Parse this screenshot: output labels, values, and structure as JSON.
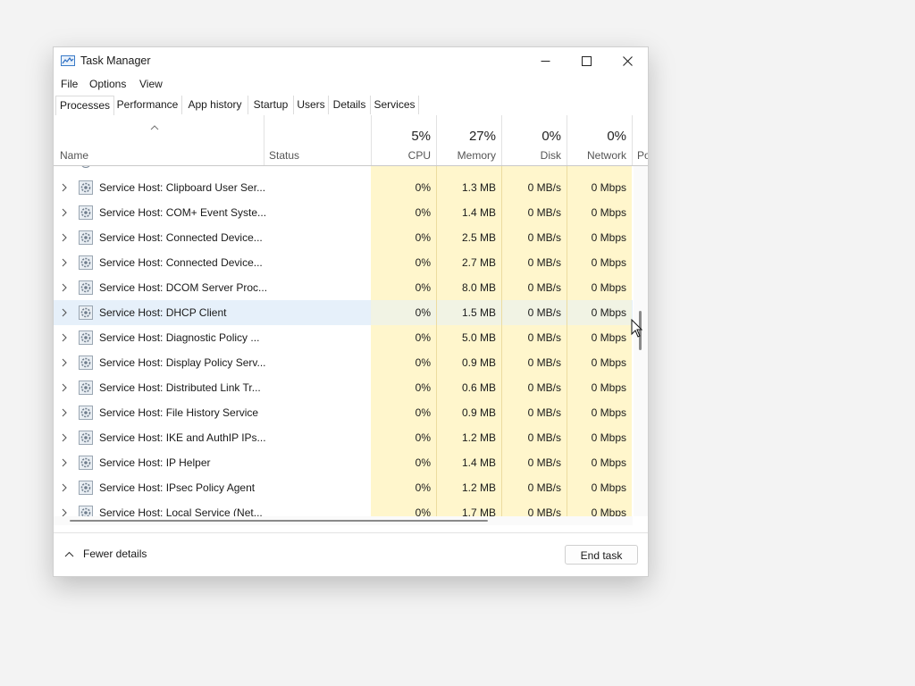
{
  "window": {
    "title": "Task Manager"
  },
  "menu": [
    "File",
    "Options",
    "View"
  ],
  "tabs": [
    "Processes",
    "Performance",
    "App history",
    "Startup",
    "Users",
    "Details",
    "Services"
  ],
  "columns": {
    "name": "Name",
    "status": "Status",
    "cpu": {
      "percent": "5%",
      "label": "CPU"
    },
    "memory": {
      "percent": "27%",
      "label": "Memory"
    },
    "disk": {
      "percent": "0%",
      "label": "Disk"
    },
    "network": {
      "percent": "0%",
      "label": "Network"
    },
    "power": "Po"
  },
  "rows": [
    {
      "name": "Service Host: Clipboard User Ser...",
      "status": "",
      "cpu": "0%",
      "memory": "1.3 MB",
      "disk": "0 MB/s",
      "network": "0 Mbps"
    },
    {
      "name": "Service Host: COM+ Event Syste...",
      "status": "",
      "cpu": "0%",
      "memory": "1.4 MB",
      "disk": "0 MB/s",
      "network": "0 Mbps"
    },
    {
      "name": "Service Host: Connected Device...",
      "status": "",
      "cpu": "0%",
      "memory": "2.5 MB",
      "disk": "0 MB/s",
      "network": "0 Mbps"
    },
    {
      "name": "Service Host: Connected Device...",
      "status": "",
      "cpu": "0%",
      "memory": "2.7 MB",
      "disk": "0 MB/s",
      "network": "0 Mbps"
    },
    {
      "name": "Service Host: DCOM Server Proc...",
      "status": "",
      "cpu": "0%",
      "memory": "8.0 MB",
      "disk": "0 MB/s",
      "network": "0 Mbps"
    },
    {
      "name": "Service Host: DHCP Client",
      "status": "",
      "cpu": "0%",
      "memory": "1.5 MB",
      "disk": "0 MB/s",
      "network": "0 Mbps",
      "selected": true
    },
    {
      "name": "Service Host: Diagnostic Policy ...",
      "status": "",
      "cpu": "0%",
      "memory": "5.0 MB",
      "disk": "0 MB/s",
      "network": "0 Mbps"
    },
    {
      "name": "Service Host: Display Policy Serv...",
      "status": "",
      "cpu": "0%",
      "memory": "0.9 MB",
      "disk": "0 MB/s",
      "network": "0 Mbps"
    },
    {
      "name": "Service Host: Distributed Link Tr...",
      "status": "",
      "cpu": "0%",
      "memory": "0.6 MB",
      "disk": "0 MB/s",
      "network": "0 Mbps"
    },
    {
      "name": "Service Host: File History Service",
      "status": "",
      "cpu": "0%",
      "memory": "0.9 MB",
      "disk": "0 MB/s",
      "network": "0 Mbps"
    },
    {
      "name": "Service Host: IKE and AuthIP IPs...",
      "status": "",
      "cpu": "0%",
      "memory": "1.2 MB",
      "disk": "0 MB/s",
      "network": "0 Mbps"
    },
    {
      "name": "Service Host: IP Helper",
      "status": "",
      "cpu": "0%",
      "memory": "1.4 MB",
      "disk": "0 MB/s",
      "network": "0 Mbps"
    },
    {
      "name": "Service Host: IPsec Policy Agent",
      "status": "",
      "cpu": "0%",
      "memory": "1.2 MB",
      "disk": "0 MB/s",
      "network": "0 Mbps"
    },
    {
      "name": "Service Host: Local Service (Net...",
      "status": "",
      "cpu": "0%",
      "memory": "1.7 MB",
      "disk": "0 MB/s",
      "network": "0 Mbps"
    }
  ],
  "footer": {
    "fewer_details": "Fewer details",
    "end_task": "End task"
  },
  "colors": {
    "usage_shade": "#fff6cc",
    "selected_row": "#e6f0fa"
  }
}
